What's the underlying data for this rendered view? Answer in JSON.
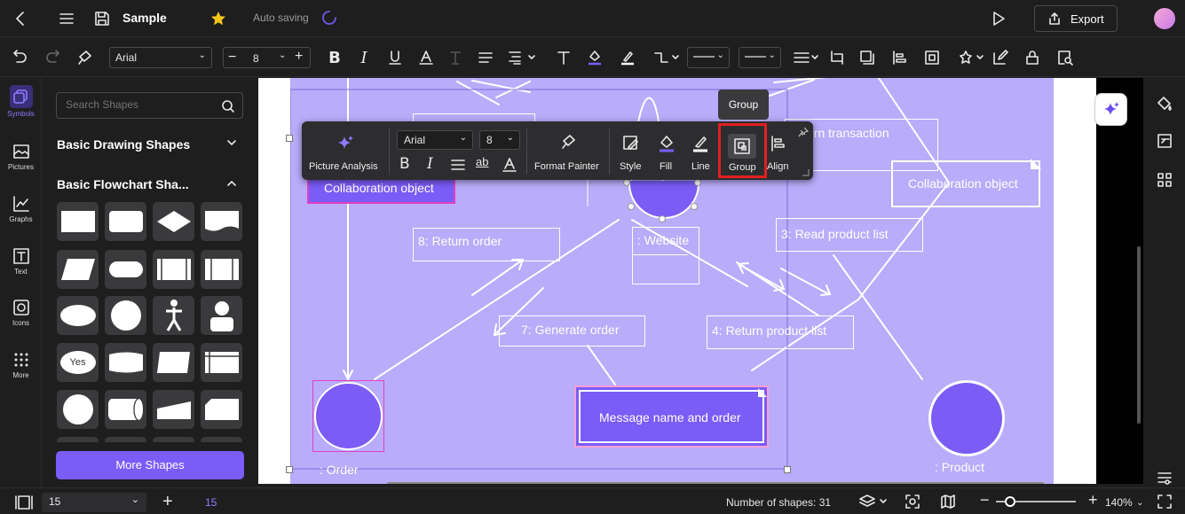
{
  "document": {
    "title": "Sample",
    "status": "Auto saving"
  },
  "header": {
    "export_label": "Export"
  },
  "format_toolbar": {
    "font": "Arial",
    "font_size": "8"
  },
  "rail": {
    "items": [
      {
        "label": "Symbols",
        "icon": "symbols-icon"
      },
      {
        "label": "Pictures",
        "icon": "pictures-icon"
      },
      {
        "label": "Graphs",
        "icon": "graphs-icon"
      },
      {
        "label": "Text",
        "icon": "text-icon"
      },
      {
        "label": "Icons",
        "icon": "icons-icon"
      },
      {
        "label": "More",
        "icon": "more-icon"
      }
    ]
  },
  "library": {
    "search_placeholder": "Search Shapes",
    "section1": "Basic Drawing Shapes",
    "section2": "Basic Flowchart Sha...",
    "yes_label": "Yes",
    "more_button": "More Shapes"
  },
  "floating_toolbar": {
    "picture_analysis": "Picture Analysis",
    "font": "Arial",
    "size": "8",
    "format_painter": "Format Painter",
    "style": "Style",
    "fill": "Fill",
    "line": "Line",
    "group": "Group",
    "align": "Align",
    "tooltip": "Group",
    "highlight_color": "#e02020"
  },
  "diagram": {
    "labels": {
      "collab_left": "Collaboration object",
      "collab_right": "Collaboration object",
      "return_transaction": "urn transaction",
      "return_order": "8: Return order",
      "website": ": Website",
      "read_product_list": "3: Read product list",
      "generate_order": "7: Generate order",
      "return_product_list": "4: Return product list",
      "message": "Message name and order",
      "order": ": Order",
      "product": ": Product"
    },
    "colors": {
      "page": "#b9acfa",
      "circle": "#7b5cf5",
      "accent": "#7a5cf7"
    }
  },
  "status_bar": {
    "page_select": "15",
    "page_tab": "15",
    "shape_count": "Number of shapes: 31",
    "zoom": "140%"
  }
}
